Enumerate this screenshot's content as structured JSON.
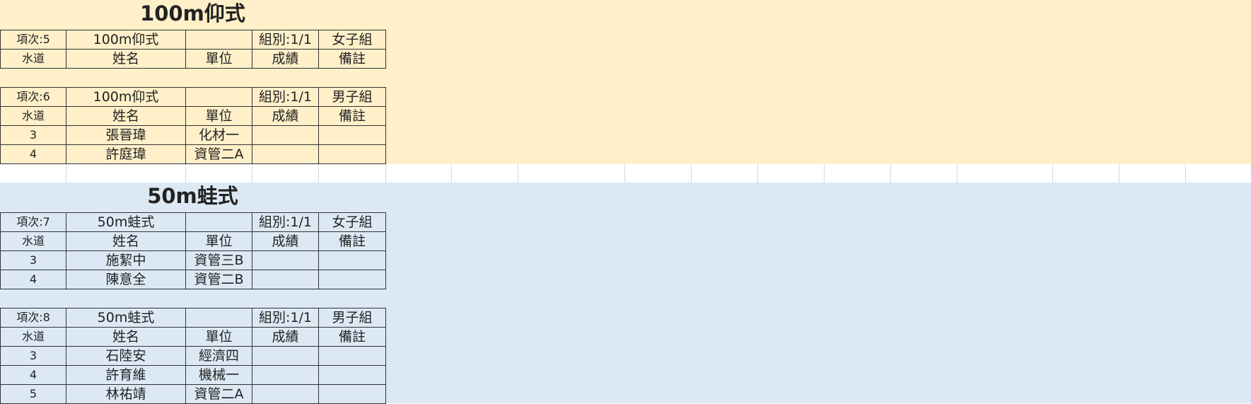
{
  "sections": [
    {
      "title": "100m仰式",
      "heats": [
        {
          "info": [
            "項次:5",
            "100m仰式",
            "",
            "組別:1/1",
            "女子組"
          ],
          "headers": [
            "水道",
            "姓名",
            "單位",
            "成績",
            "備註"
          ],
          "rows": []
        },
        {
          "info": [
            "項次:6",
            "100m仰式",
            "",
            "組別:1/1",
            "男子組"
          ],
          "headers": [
            "水道",
            "姓名",
            "單位",
            "成績",
            "備註"
          ],
          "rows": [
            [
              "3",
              "張晉瑋",
              "化材一",
              "",
              ""
            ],
            [
              "4",
              "許庭瑋",
              "資管二A",
              "",
              ""
            ]
          ]
        }
      ]
    },
    {
      "title": "50m蛙式",
      "heats": [
        {
          "info": [
            "項次:7",
            "50m蛙式",
            "",
            "組別:1/1",
            "女子組"
          ],
          "headers": [
            "水道",
            "姓名",
            "單位",
            "成績",
            "備註"
          ],
          "rows": [
            [
              "3",
              "施絜中",
              "資管三B",
              "",
              ""
            ],
            [
              "4",
              "陳意全",
              "資管二B",
              "",
              ""
            ]
          ]
        },
        {
          "info": [
            "項次:8",
            "50m蛙式",
            "",
            "組別:1/1",
            "男子組"
          ],
          "headers": [
            "水道",
            "姓名",
            "單位",
            "成績",
            "備註"
          ],
          "rows": [
            [
              "3",
              "石陸安",
              "經濟四",
              "",
              ""
            ],
            [
              "4",
              "許育維",
              "機械一",
              "",
              ""
            ],
            [
              "5",
              "林祐靖",
              "資管二A",
              "",
              ""
            ]
          ]
        }
      ]
    }
  ],
  "colors": {
    "section1_background": "#fff0c9",
    "section2_background": "#dce9f5",
    "separator_row": "#ffffff"
  }
}
